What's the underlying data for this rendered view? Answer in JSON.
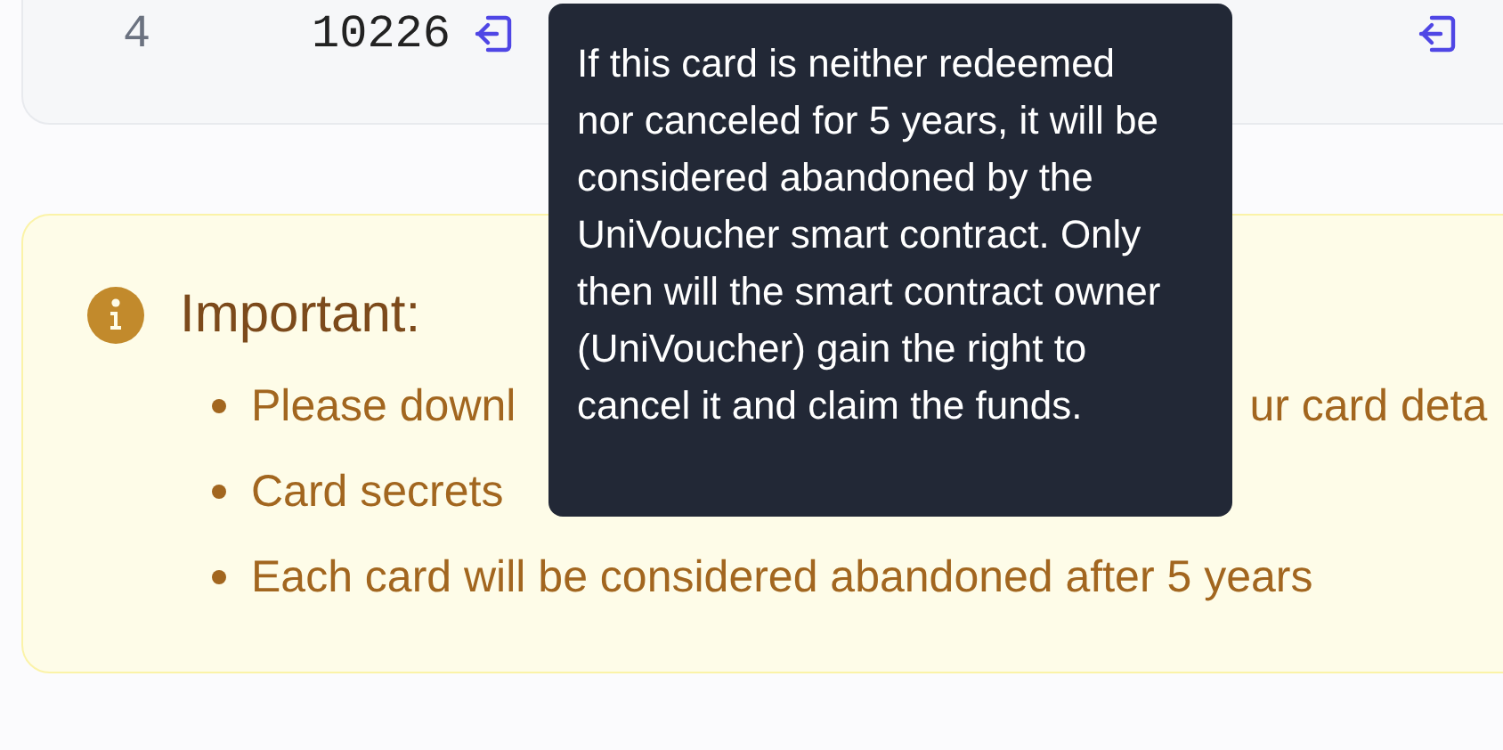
{
  "card_row": {
    "index": "4",
    "amount": "10226"
  },
  "notice": {
    "title": "Important:",
    "items": [
      {
        "segments": [
          "Please downl",
          "ur card deta"
        ]
      },
      {
        "segments": [
          "Card secrets"
        ]
      },
      {
        "segments": [
          "Each card will be considered abandoned after 5 years"
        ]
      }
    ]
  },
  "tooltip": {
    "text": "If this card is neither redeemed nor canceled for 5 years, it will be considered abandoned by the UniVoucher smart contract. Only then will the smart contract owner (UniVoucher) gain the right to cancel it and claim the funds."
  }
}
